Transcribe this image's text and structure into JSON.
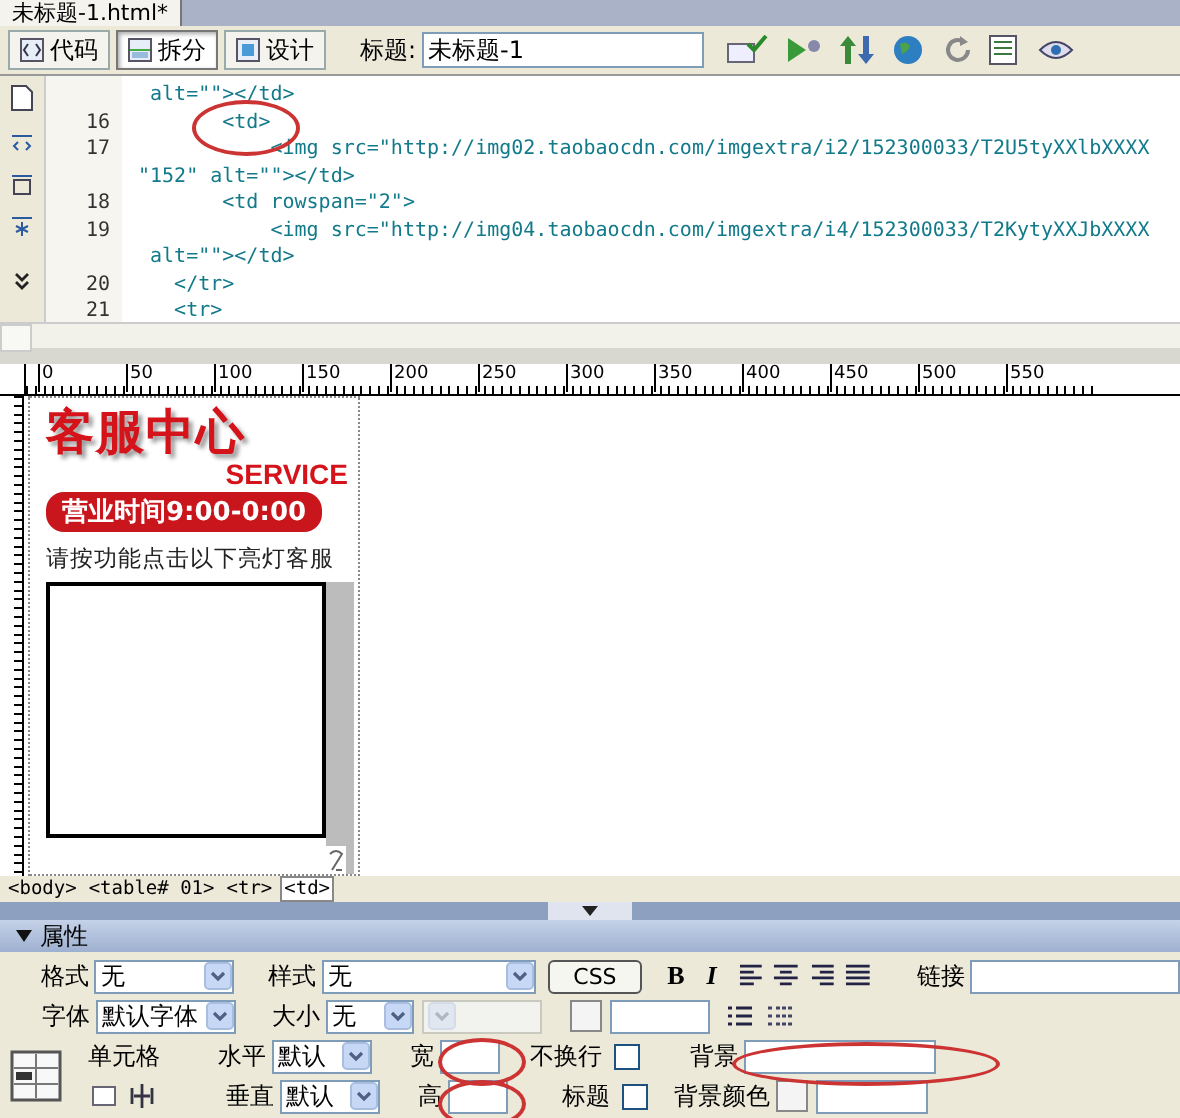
{
  "document_tab": {
    "title": "未标题-1.html*"
  },
  "toolbar": {
    "views": [
      {
        "label": "代码",
        "selected": false
      },
      {
        "label": "拆分",
        "selected": true
      },
      {
        "label": "设计",
        "selected": false
      }
    ],
    "title_label": "标题:",
    "title_value": "未标题-1"
  },
  "code": {
    "lines": [
      {
        "text": " alt=\"\"></td>"
      },
      {
        "number": "16",
        "text": "       <td>"
      },
      {
        "number": "17",
        "text": "           <img src=\"http://img02.taobaocdn.com/imgextra/i2/152300033/T2U5tyXXlbXXXX"
      },
      {
        "text": "\"152\" alt=\"\"></td>"
      },
      {
        "number": "18",
        "text": "       <td rowspan=\"2\">"
      },
      {
        "number": "19",
        "text": "           <img src=\"http://img04.taobaocdn.com/imgextra/i4/152300033/T2KytyXXJbXXXX"
      },
      {
        "text": " alt=\"\"></td>"
      },
      {
        "number": "20",
        "text": "   </tr>"
      },
      {
        "number": "21",
        "text": "   <tr>"
      }
    ]
  },
  "ruler": {
    "labels": [
      "0",
      "50",
      "100",
      "150",
      "200",
      "250",
      "300",
      "350",
      "400",
      "450",
      "500",
      "550"
    ]
  },
  "design": {
    "heading": "客服中心",
    "subheading": "SERVICE",
    "hours": "营业时间9:00-0:00",
    "note": "请按功能点击以下亮灯客服"
  },
  "tag_selector": [
    {
      "label": "<body>",
      "selected": false
    },
    {
      "label": "<table#  01>",
      "selected": false
    },
    {
      "label": "<tr>",
      "selected": false
    },
    {
      "label": "<td>",
      "selected": true
    }
  ],
  "properties": {
    "title": "属性",
    "expanded": true,
    "format": {
      "label": "格式",
      "value": "无"
    },
    "style": {
      "label": "样式",
      "value": "无"
    },
    "css_button": "CSS",
    "bold": "B",
    "italic": "I",
    "link_label": "链接",
    "font": {
      "label": "字体",
      "value": "默认字体"
    },
    "size": {
      "label": "大小",
      "value": "无"
    },
    "cell_label": "单元格",
    "horizontal": {
      "label": "水平",
      "value": "默认"
    },
    "vertical": {
      "label": "垂直",
      "value": "默认"
    },
    "width_label": "宽",
    "height_label": "高",
    "nowrap": {
      "label": "不换行",
      "checked": false
    },
    "header": {
      "label": "标题",
      "checked": false
    },
    "bg_label": "背景",
    "bg_color_label": "背景颜色"
  }
}
